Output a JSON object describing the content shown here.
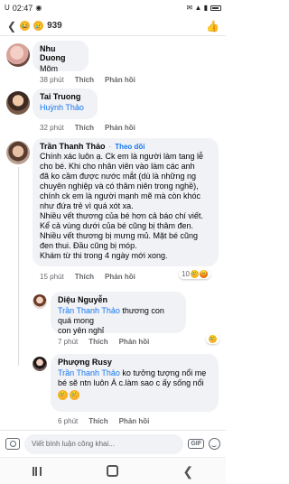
{
  "status": {
    "time": "02:47",
    "carrier_left": "U",
    "icons_right": "✉ ▲ ▮"
  },
  "reactions": {
    "count": "939"
  },
  "comments": [
    {
      "name": "Nhu Duong",
      "text": "Mõm",
      "time": "38 phút",
      "like": "Thích",
      "reply": "Phản hồi"
    },
    {
      "name": "Tai Truong",
      "tag": "Huỳnh Thảo",
      "time": "32 phút",
      "like": "Thích",
      "reply": "Phản hồi"
    },
    {
      "name": "Trần Thanh Thảo",
      "follow": "Theo dõi",
      "lines": [
        "Chính xác luôn ạ. Ck em là người làm tang lễ",
        "cho bé. Khi cho nhân viên vào làm các anh",
        "đã ko cầm được nước mắt (dù là những ng",
        "chuyên nghiệp và có thâm niên trong nghề),",
        "chính ck em là người mạnh mẽ mà còn khóc",
        "như đứa trẻ vì quá xót xa.",
        "Nhiều vết thương của bé hơn cả báo chí viết.",
        "Kể cả vùng dưới của bé cũng bị thâm đen.",
        "Nhiều vết thương bị mưng mủ. Mặt bé cũng",
        "đen thui. Đầu cũng bị móp.",
        "Khám từ thi trong 4 ngày mới xong."
      ],
      "time": "15 phút",
      "like": "Thích",
      "reply": "Phản hồi",
      "reaction_count": "10"
    },
    {
      "name": "Diệu Nguyễn",
      "tag": "Trần Thanh Thảo",
      "text_line1": "thương con quá mong",
      "text_line2": "con yên nghỉ",
      "time": "7 phút",
      "like": "Thích",
      "reply": "Phản hồi"
    },
    {
      "name": "Phượng Rusy",
      "tag": "Trần Thanh Thảo",
      "text_line1": "ko tưởng tượng nổi mẹ",
      "text_line2": "bé sẽ ntn luôn Á c.làm sao c ấy sống nổi",
      "time": "6 phút",
      "like": "Thích",
      "reply": "Phản hồi"
    }
  ],
  "compose": {
    "placeholder": "Viết bình luận công khai...",
    "gif": "GIF"
  }
}
